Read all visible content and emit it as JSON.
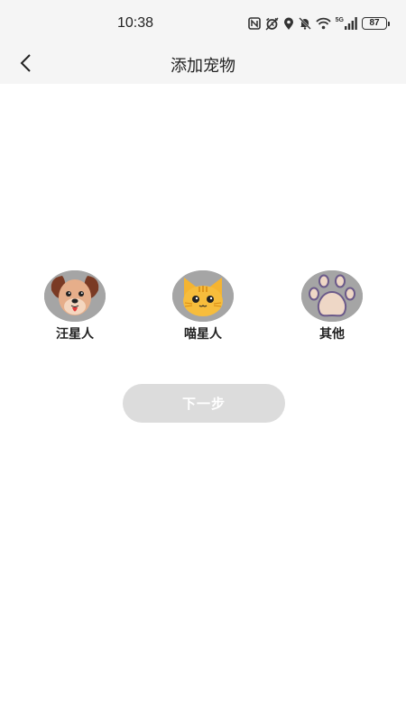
{
  "status_bar": {
    "time": "10:38",
    "network_label": "5G",
    "battery_level": "87",
    "icons": [
      "nfc-icon",
      "alarm-icon",
      "location-icon",
      "mute-icon",
      "wifi-icon",
      "signal-icon",
      "battery-icon"
    ]
  },
  "header": {
    "back_icon": "chevron-left-icon",
    "title": "添加宠物"
  },
  "pets": [
    {
      "label": "汪星人",
      "icon": "dog-icon"
    },
    {
      "label": "喵星人",
      "icon": "cat-icon"
    },
    {
      "label": "其他",
      "icon": "paw-icon"
    }
  ],
  "next_button": {
    "label": "下一步",
    "state": "disabled"
  },
  "colors": {
    "background": "#ffffff",
    "bar_background": "#f5f5f5",
    "avatar_background": "#a5a5a5",
    "button_disabled": "#dcdcdc",
    "button_text": "#ffffff"
  }
}
